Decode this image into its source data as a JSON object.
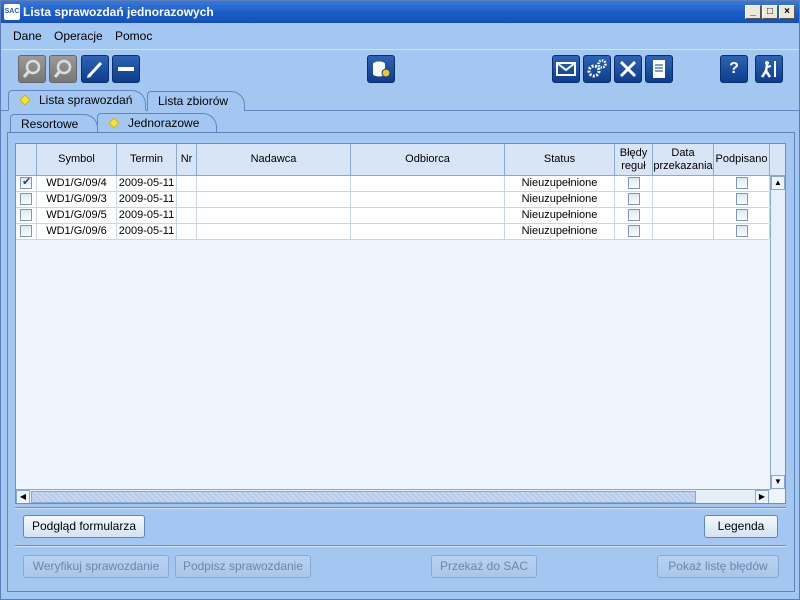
{
  "window": {
    "title": "Lista sprawozdań jednorazowych",
    "logo": "SAC",
    "min": "_",
    "max": "□",
    "close": "×"
  },
  "menu": [
    "Dane",
    "Operacje",
    "Pomoc"
  ],
  "toolbar": {
    "icons": [
      "preview-zoom-icon",
      "search-icon",
      "edit-pencil-icon",
      "remove-minus-icon",
      "database-icon",
      "mail-icon",
      "settings-gears-icon",
      "tools-icon",
      "document-icon",
      "help-icon",
      "exit-icon"
    ]
  },
  "tabs_top": [
    {
      "label": "Lista sprawozdań",
      "active": true
    },
    {
      "label": "Lista zbiorów",
      "active": false
    }
  ],
  "tabs_sub": [
    {
      "label": "Resortowe",
      "active": false
    },
    {
      "label": "Jednorazowe",
      "active": true
    }
  ],
  "table": {
    "headers": {
      "symbol": "Symbol",
      "termin": "Termin",
      "nr": "Nr",
      "nadawca": "Nadawca",
      "odbiorca": "Odbiorca",
      "status": "Status",
      "bledy1": "Błędy",
      "bledy2": "reguł",
      "data1": "Data",
      "data2": "przekazania",
      "podpisano": "Podpisano"
    },
    "rows": [
      {
        "checked": true,
        "symbol": "WD1/G/09/4",
        "termin": "2009-05-11",
        "nr": "",
        "nadawca": "",
        "odbiorca": "",
        "status": "Nieuzupełnione"
      },
      {
        "checked": false,
        "symbol": "WD1/G/09/3",
        "termin": "2009-05-11",
        "nr": "",
        "nadawca": "",
        "odbiorca": "",
        "status": "Nieuzupełnione"
      },
      {
        "checked": false,
        "symbol": "WD1/G/09/5",
        "termin": "2009-05-11",
        "nr": "",
        "nadawca": "",
        "odbiorca": "",
        "status": "Nieuzupełnione"
      },
      {
        "checked": false,
        "symbol": "WD1/G/09/6",
        "termin": "2009-05-11",
        "nr": "",
        "nadawca": "",
        "odbiorca": "",
        "status": "Nieuzupełnione"
      }
    ]
  },
  "buttons": {
    "podglad": "Podgląd formularza",
    "legenda": "Legenda",
    "weryfikuj": "Weryfikuj sprawozdanie",
    "podpisz": "Podpisz sprawozdanie",
    "przekaz": "Przekaż do SAC",
    "pokaz": "Pokaż listę błędów"
  }
}
